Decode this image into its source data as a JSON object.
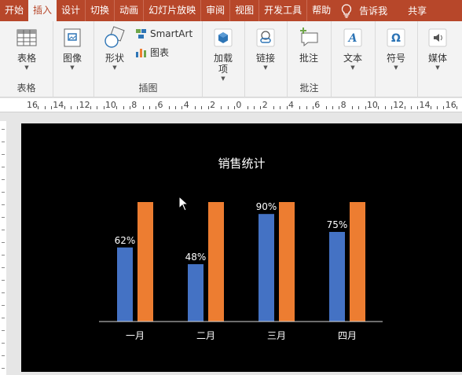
{
  "ribbon_tabs": [
    {
      "label": "开始",
      "active": false
    },
    {
      "label": "插入",
      "active": true
    },
    {
      "label": "设计",
      "active": false
    },
    {
      "label": "切换",
      "active": false
    },
    {
      "label": "动画",
      "active": false
    },
    {
      "label": "幻灯片放映",
      "active": false
    },
    {
      "label": "审阅",
      "active": false
    },
    {
      "label": "视图",
      "active": false
    },
    {
      "label": "开发工具",
      "active": false
    },
    {
      "label": "帮助",
      "active": false
    }
  ],
  "tell_me": "告诉我",
  "share": "共享",
  "groups": {
    "tables": {
      "label": "表格",
      "table_button": "表格"
    },
    "images": {
      "image_button": "图像"
    },
    "illustrations": {
      "label": "插图",
      "shapes_button": "形状",
      "smartart_button": "SmartArt",
      "chart_button": "图表"
    },
    "addins": {
      "addins_button": "加载项"
    },
    "links": {
      "link_button": "链接"
    },
    "comments": {
      "label": "批注",
      "comment_button": "批注"
    },
    "text": {
      "text_button": "文本"
    },
    "symbols": {
      "symbol_button": "符号"
    },
    "media": {
      "media_button": "媒体"
    }
  },
  "ruler_labels": [
    "16",
    "14",
    "12",
    "10",
    "8",
    "6",
    "4",
    "2",
    "0",
    "2",
    "4",
    "6",
    "8",
    "10",
    "12",
    "14",
    "16"
  ],
  "colors": {
    "accent": "#b7472a",
    "series_blue": "#4472c4",
    "series_orange": "#ed7d31"
  },
  "chart_data": {
    "type": "bar",
    "title": "销售统计",
    "categories": [
      "一月",
      "二月",
      "三月",
      "四月"
    ],
    "series": [
      {
        "values": [
          62,
          48,
          90,
          75
        ],
        "labels": [
          "62%",
          "48%",
          "90%",
          "75%"
        ]
      },
      {
        "values": [
          100,
          100,
          100,
          100
        ]
      }
    ],
    "ylim": [
      0,
      100
    ],
    "grid": false,
    "legend": "none"
  }
}
